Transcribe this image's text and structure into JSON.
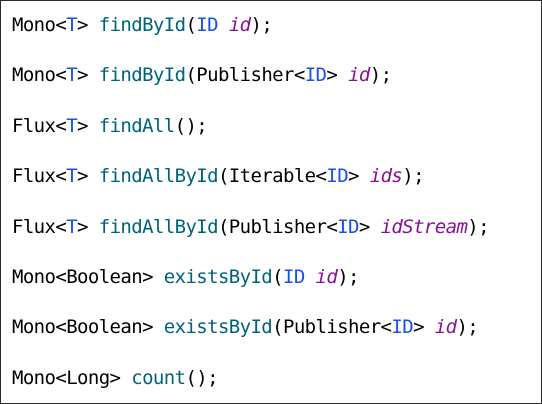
{
  "colors": {
    "background": "#ffffff",
    "plain": "#000000",
    "type_parameter": "#1750eb",
    "method": "#00627a",
    "parameter": "#871094"
  },
  "code": {
    "lines": [
      {
        "tokens": [
          {
            "text": "Mono<",
            "kind": "plain"
          },
          {
            "text": "T",
            "kind": "type"
          },
          {
            "text": "> ",
            "kind": "plain"
          },
          {
            "text": "findById",
            "kind": "method"
          },
          {
            "text": "(",
            "kind": "plain"
          },
          {
            "text": "ID",
            "kind": "type"
          },
          {
            "text": " ",
            "kind": "plain"
          },
          {
            "text": "id",
            "kind": "param"
          },
          {
            "text": ");",
            "kind": "plain"
          }
        ]
      },
      {
        "tokens": [
          {
            "text": "Mono<",
            "kind": "plain"
          },
          {
            "text": "T",
            "kind": "type"
          },
          {
            "text": "> ",
            "kind": "plain"
          },
          {
            "text": "findById",
            "kind": "method"
          },
          {
            "text": "(Publisher<",
            "kind": "plain"
          },
          {
            "text": "ID",
            "kind": "type"
          },
          {
            "text": "> ",
            "kind": "plain"
          },
          {
            "text": "id",
            "kind": "param"
          },
          {
            "text": ");",
            "kind": "plain"
          }
        ]
      },
      {
        "tokens": [
          {
            "text": "Flux<",
            "kind": "plain"
          },
          {
            "text": "T",
            "kind": "type"
          },
          {
            "text": "> ",
            "kind": "plain"
          },
          {
            "text": "findAll",
            "kind": "method"
          },
          {
            "text": "();",
            "kind": "plain"
          }
        ]
      },
      {
        "tokens": [
          {
            "text": "Flux<",
            "kind": "plain"
          },
          {
            "text": "T",
            "kind": "type"
          },
          {
            "text": "> ",
            "kind": "plain"
          },
          {
            "text": "findAllById",
            "kind": "method"
          },
          {
            "text": "(Iterable<",
            "kind": "plain"
          },
          {
            "text": "ID",
            "kind": "type"
          },
          {
            "text": "> ",
            "kind": "plain"
          },
          {
            "text": "ids",
            "kind": "param"
          },
          {
            "text": ");",
            "kind": "plain"
          }
        ]
      },
      {
        "tokens": [
          {
            "text": "Flux<",
            "kind": "plain"
          },
          {
            "text": "T",
            "kind": "type"
          },
          {
            "text": "> ",
            "kind": "plain"
          },
          {
            "text": "findAllById",
            "kind": "method"
          },
          {
            "text": "(Publisher<",
            "kind": "plain"
          },
          {
            "text": "ID",
            "kind": "type"
          },
          {
            "text": "> ",
            "kind": "plain"
          },
          {
            "text": "idStream",
            "kind": "param"
          },
          {
            "text": ");",
            "kind": "plain"
          }
        ]
      },
      {
        "tokens": [
          {
            "text": "Mono<Boolean> ",
            "kind": "plain"
          },
          {
            "text": "existsById",
            "kind": "method"
          },
          {
            "text": "(",
            "kind": "plain"
          },
          {
            "text": "ID",
            "kind": "type"
          },
          {
            "text": " ",
            "kind": "plain"
          },
          {
            "text": "id",
            "kind": "param"
          },
          {
            "text": ");",
            "kind": "plain"
          }
        ]
      },
      {
        "tokens": [
          {
            "text": "Mono<Boolean> ",
            "kind": "plain"
          },
          {
            "text": "existsById",
            "kind": "method"
          },
          {
            "text": "(Publisher<",
            "kind": "plain"
          },
          {
            "text": "ID",
            "kind": "type"
          },
          {
            "text": "> ",
            "kind": "plain"
          },
          {
            "text": "id",
            "kind": "param"
          },
          {
            "text": ");",
            "kind": "plain"
          }
        ]
      },
      {
        "tokens": [
          {
            "text": "Mono<Long> ",
            "kind": "plain"
          },
          {
            "text": "count",
            "kind": "method"
          },
          {
            "text": "();",
            "kind": "plain"
          }
        ]
      }
    ]
  }
}
